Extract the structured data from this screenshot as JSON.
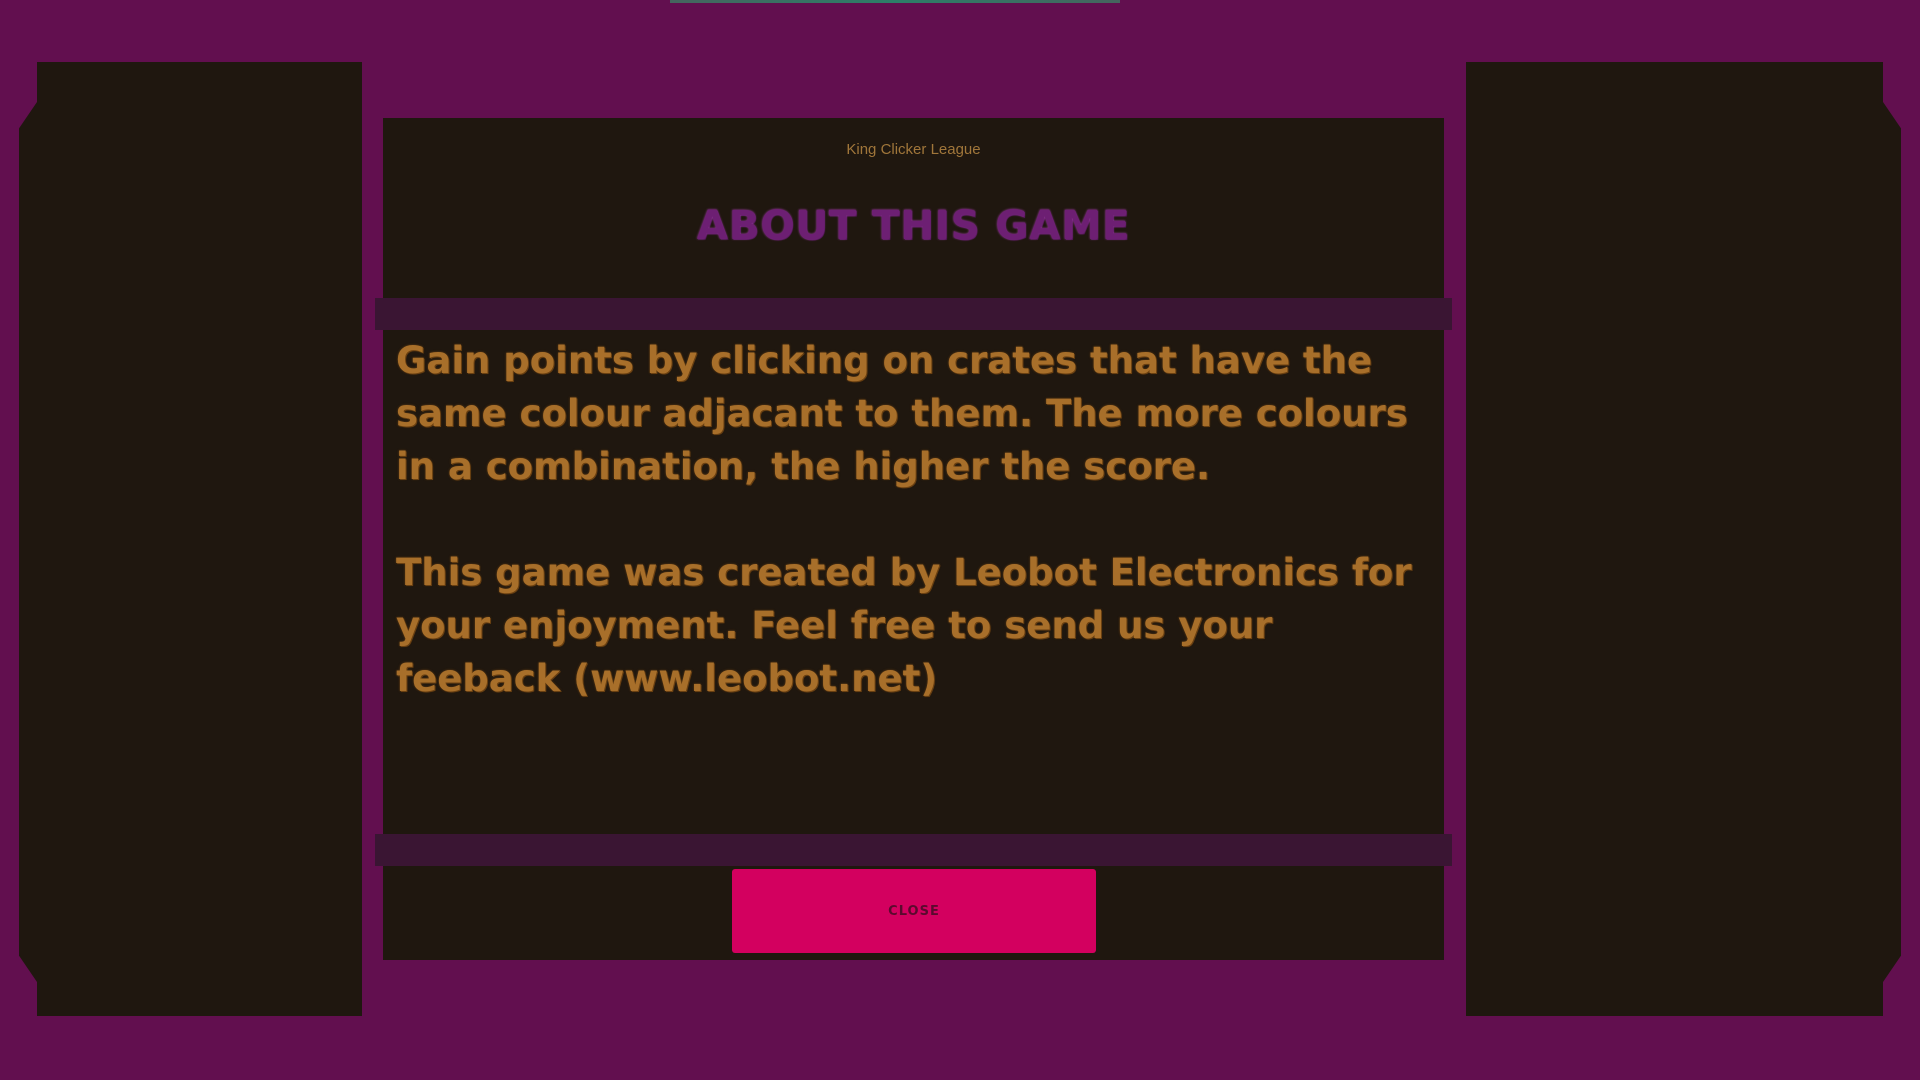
{
  "colors": {
    "frame": "#620f4f",
    "panel": "#1f170f",
    "accent_text": "#a86f2a",
    "title": "#6d1f73",
    "close_button": "#d3005f"
  },
  "dialog": {
    "subtitle": "King Clicker League",
    "title": "ABOUT THIS GAME",
    "paragraphs": [
      "Gain points by clicking on crates that have the same colour adjacant to them. The more colours in a combination, the higher the score.",
      "This game was created by Leobot Electronics for your enjoyment. Feel free to send us your feeback (www.leobot.net)"
    ],
    "close_label": "CLOSE"
  }
}
